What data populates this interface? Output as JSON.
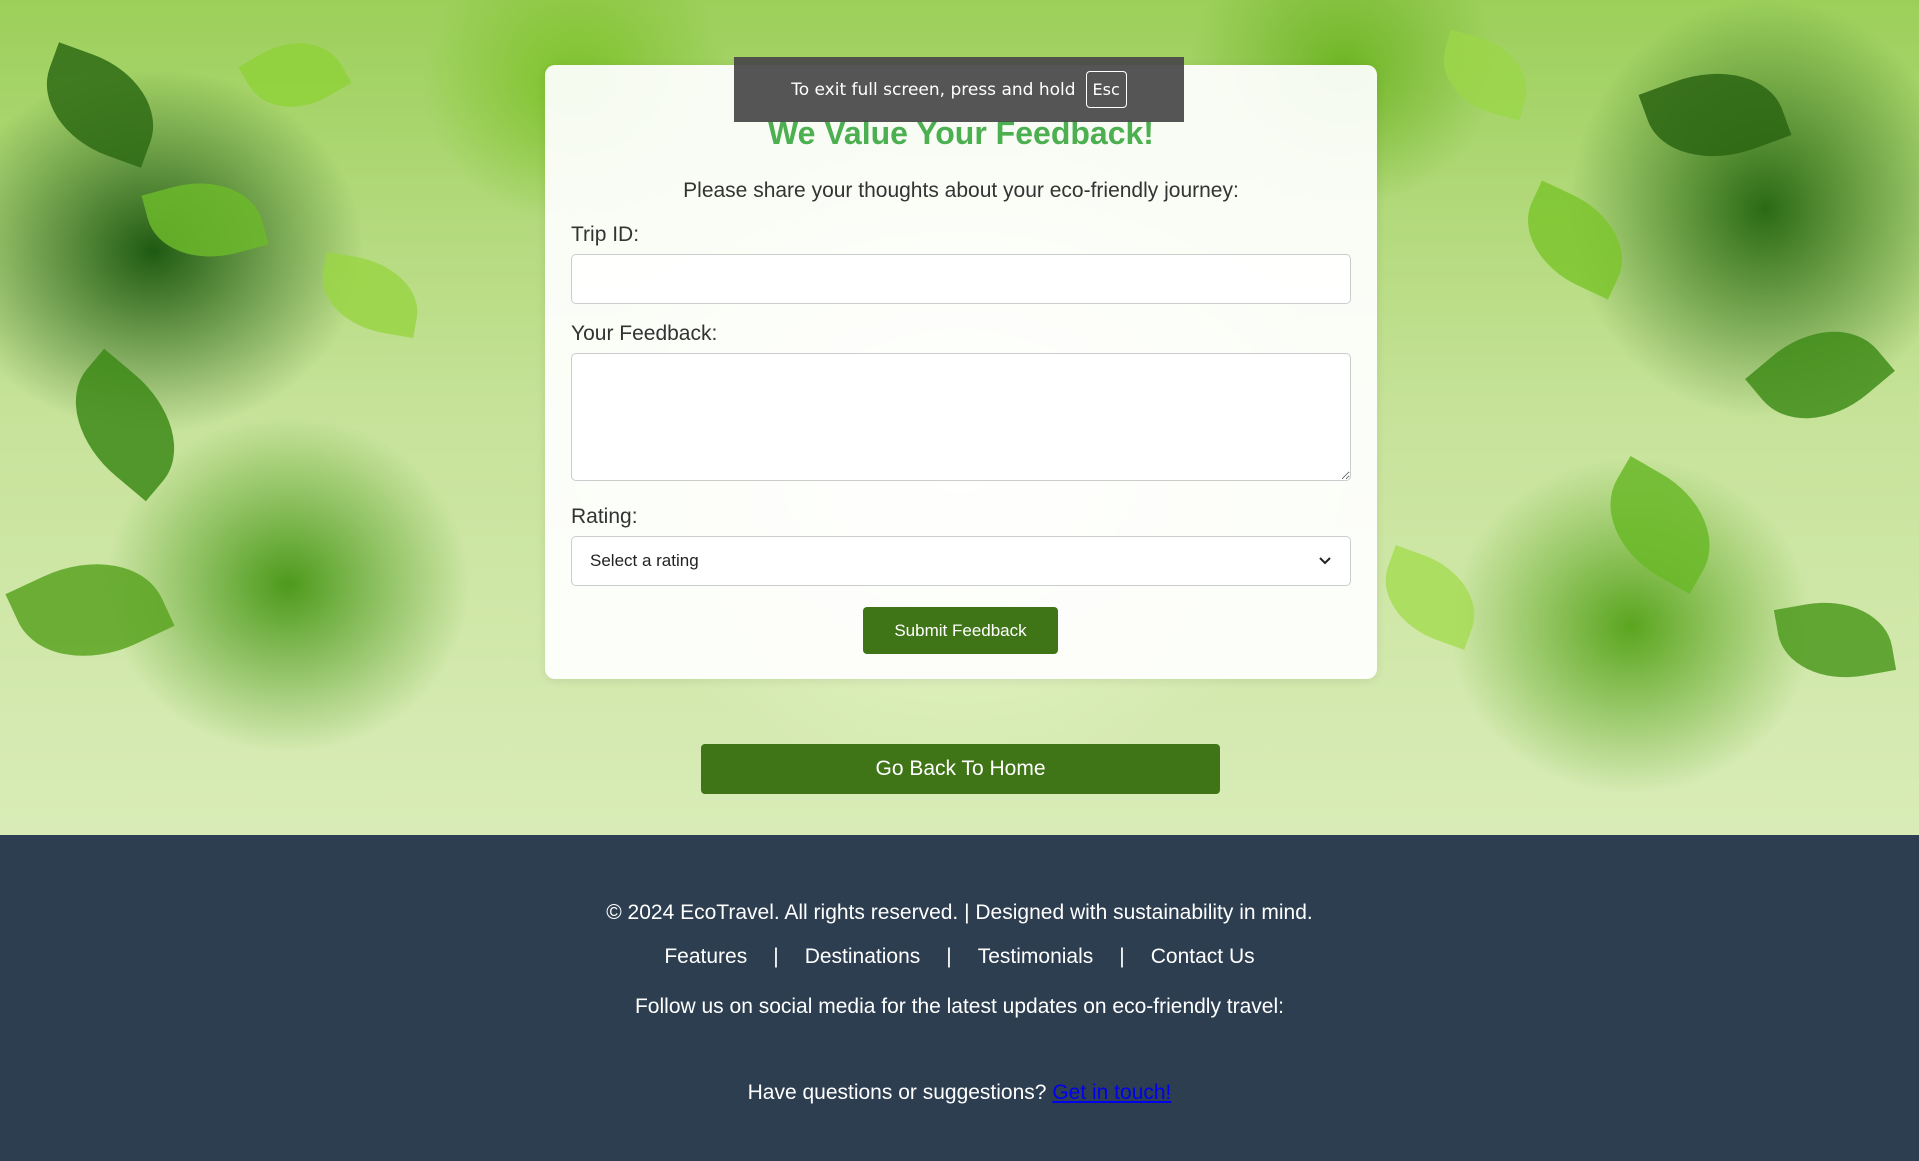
{
  "fullscreen_notice": {
    "text": "To exit full screen, press and hold",
    "key": "Esc"
  },
  "feedback_form": {
    "title": "We Value Your Feedback!",
    "intro": "Please share your thoughts about your eco-friendly journey:",
    "trip_id_label": "Trip ID:",
    "trip_id_value": "",
    "feedback_label": "Your Feedback:",
    "feedback_value": "",
    "rating_label": "Rating:",
    "rating_selected": "Select a rating",
    "submit_label": "Submit Feedback"
  },
  "home_button_label": "Go Back To Home",
  "footer": {
    "copyright": "© 2024 EcoTravel. All rights reserved. | Designed with sustainability in mind.",
    "nav": [
      "Features",
      "Destinations",
      "Testimonials",
      "Contact Us"
    ],
    "separator": "|",
    "social_text": "Follow us on social media for the latest updates on eco-friendly travel:",
    "contact_text": "Have questions or suggestions?",
    "contact_link": "Get in touch!"
  },
  "colors": {
    "accent_green": "#4caf50",
    "button_green": "#3f7517",
    "footer_bg": "#2c3e50",
    "link_blue": "#0000ee"
  }
}
